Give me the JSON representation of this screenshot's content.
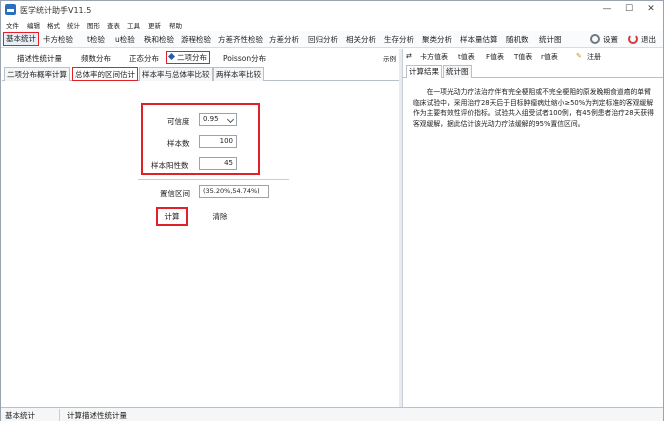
{
  "window": {
    "title": "医学统计助手V11.5",
    "minimize": "—",
    "maximize": "☐",
    "close": "✕"
  },
  "menu": [
    "文件",
    "编辑",
    "格式",
    "统计",
    "图形",
    "查表",
    "工具",
    "更新",
    "帮助"
  ],
  "toolbar": {
    "items": [
      "基本统计",
      "卡方检验",
      "t检验",
      "u检验",
      "秩和检验",
      "游程检验",
      "方差齐性检验",
      "方差分析",
      "回归分析",
      "相关分析",
      "生存分析",
      "聚类分析",
      "样本量估算",
      "随机数",
      "统计图"
    ],
    "settings": "设置",
    "exit": "退出"
  },
  "tabs": {
    "items": [
      "描述性统计量",
      "频数分布",
      "正态分布",
      "二项分布",
      "Poisson分布"
    ],
    "active": "二项分布",
    "example": "示例"
  },
  "subtabs": [
    "二项分布概率计算",
    "总体率的区间估计",
    "样本率与总体率比较",
    "两样本率比较"
  ],
  "form": {
    "confidence_label": "可信度",
    "confidence_value": "0.95",
    "sample_label": "样本数",
    "sample_value": "100",
    "positive_label": "样本阳性数",
    "positive_value": "45",
    "ci_label": "置信区间",
    "ci_value": "(35.20%,54.74%)",
    "calc_button": "计算",
    "clear_button": "清除"
  },
  "right_toolbar": {
    "items": [
      "卡方值表",
      "t值表",
      "F值表",
      "T值表",
      "r值表"
    ],
    "note": "注册"
  },
  "right_tabs": [
    "计算结果",
    "统计图"
  ],
  "result_text": "在一项光动力疗法治疗伴有完全梗阻或不完全梗阻的原发晚期食道癌的单臂临床试验中，采用治疗28天后于目标肿瘤病灶缩小≥50%为判定标准的客观缓解作为主要有效性评价指标。试验共入组受试者100例，有45例患者治疗28天获得客观缓解，据此估计该光动力疗法缓解的95%置信区间。",
  "status": {
    "left": "基本统计",
    "right": "计算描述性统计量"
  }
}
